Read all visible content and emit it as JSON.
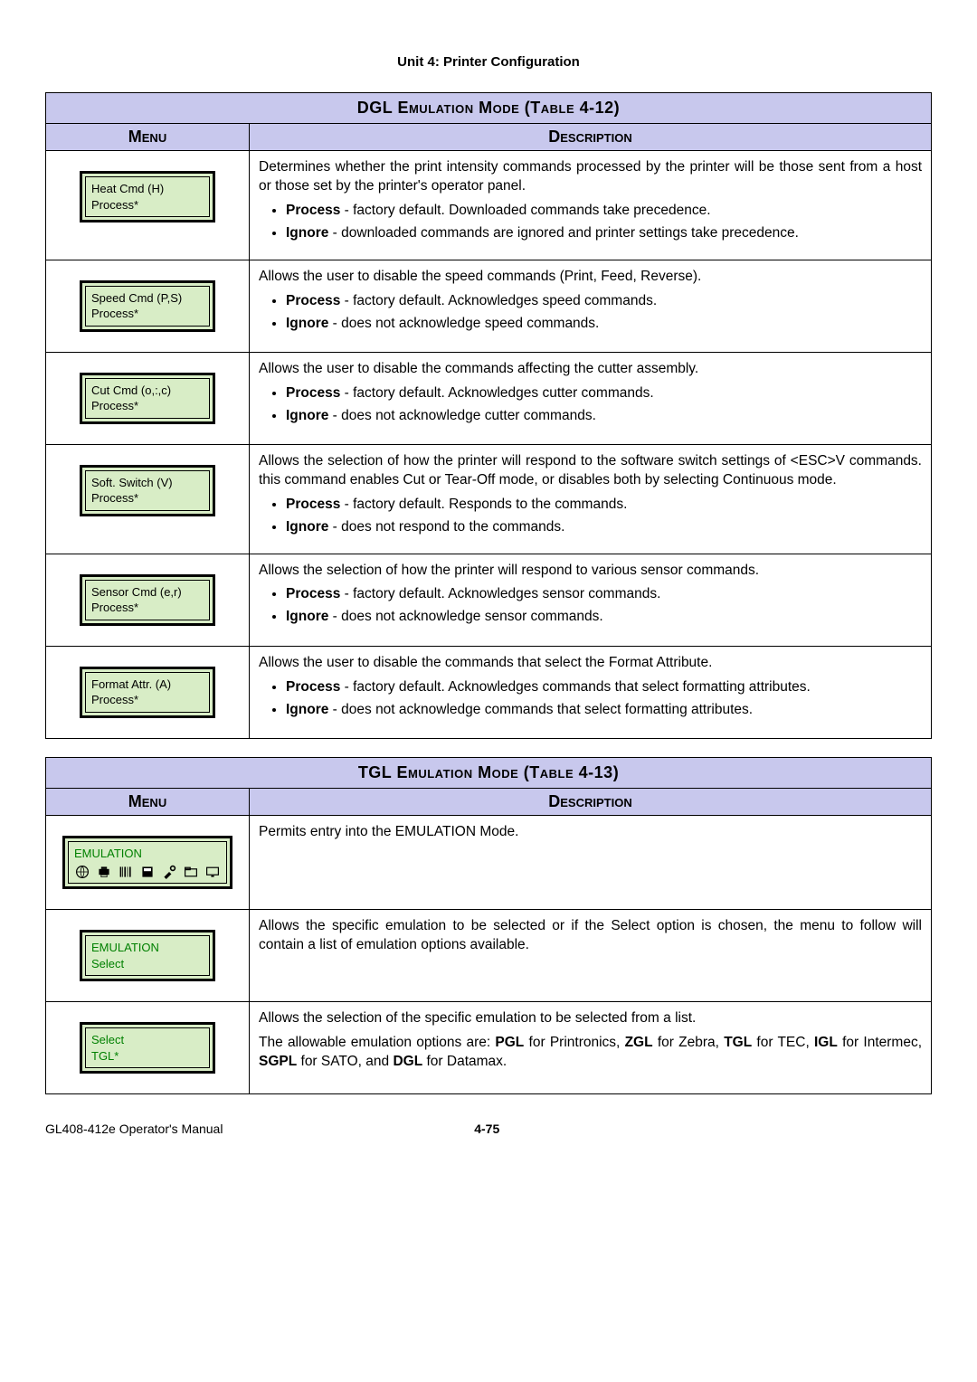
{
  "unit_header": "Unit 4:  Printer Configuration",
  "table1": {
    "title": "DGL Emulation Mode (Table 4-12)",
    "menu_header": "Menu",
    "desc_header": "Description",
    "rows": [
      {
        "menu_line1": "Heat Cmd (H)",
        "menu_line2": "Process*",
        "desc_intro": "Determines whether the print intensity commands processed by the printer will be those sent from a host or those set by the printer's operator panel.",
        "opt1_label": "Process",
        "opt1_text": " - factory default. Downloaded commands take precedence.",
        "opt2_label": "Ignore",
        "opt2_text": " - downloaded commands are ignored and printer settings take precedence."
      },
      {
        "menu_line1": "Speed Cmd (P,S)",
        "menu_line2": "Process*",
        "desc_intro": "Allows the user to disable the speed commands (Print, Feed, Reverse).",
        "opt1_label": "Process",
        "opt1_text": " - factory default. Acknowledges speed commands.",
        "opt2_label": "Ignore",
        "opt2_text": " - does not acknowledge speed commands."
      },
      {
        "menu_line1": "Cut Cmd (o,:,c)",
        "menu_line2": "Process*",
        "desc_intro": "Allows the user to disable the commands affecting the cutter assembly.",
        "opt1_label": "Process",
        "opt1_text": " - factory default. Acknowledges cutter commands.",
        "opt2_label": "Ignore",
        "opt2_text": " - does not acknowledge cutter commands."
      },
      {
        "menu_line1": "Soft. Switch (V)",
        "menu_line2": "Process*",
        "desc_intro": "Allows the selection of how the printer will respond to the software switch settings of <ESC>V commands. this command enables Cut or Tear-Off mode, or disables both by selecting Continuous mode.",
        "opt1_label": "Process",
        "opt1_text": " - factory default. Responds to the commands.",
        "opt2_label": "Ignore",
        "opt2_text": " - does not respond to the commands."
      },
      {
        "menu_line1": "Sensor Cmd (e,r)",
        "menu_line2": "Process*",
        "desc_intro": "Allows the selection of how the printer will respond to various sensor commands.",
        "opt1_label": "Process",
        "opt1_text": " - factory default. Acknowledges sensor commands.",
        "opt2_label": "Ignore",
        "opt2_text": " - does not acknowledge sensor commands."
      },
      {
        "menu_line1": "Format Attr. (A)",
        "menu_line2": "Process*",
        "desc_intro": "Allows the user to disable the commands that select the Format Attribute.",
        "opt1_label": "Process",
        "opt1_text": " - factory default. Acknowledges commands that select formatting attributes.",
        "opt2_label": "Ignore",
        "opt2_text": " - does not acknowledge commands that select formatting attributes."
      }
    ]
  },
  "table2": {
    "title": "TGL Emulation Mode (Table 4-13)",
    "menu_header": "Menu",
    "desc_header": "Description",
    "rows": [
      {
        "menu_line1": "EMULATION",
        "menu_line2": "",
        "has_icons": true,
        "desc_intro": "Permits entry into the EMULATION Mode.",
        "extra": ""
      },
      {
        "menu_line1": "EMULATION",
        "menu_line2": "Select",
        "has_icons": false,
        "desc_intro": "Allows the specific emulation to be selected or if the Select option is chosen, the menu to follow will contain a list of emulation options available.",
        "extra": ""
      },
      {
        "menu_line1": "Select",
        "menu_line2": "TGL*",
        "has_icons": false,
        "desc_intro": "Allows the selection of the specific emulation to be selected from a list.",
        "extra_pre": "The allowable emulation options are: ",
        "b1": "PGL",
        "t1": " for Printronics, ",
        "b2": "ZGL",
        "t2": " for Zebra, ",
        "b3": "TGL",
        "t3": " for TEC, ",
        "b4": "IGL",
        "t4": " for Intermec, ",
        "b5": "SGPL",
        "t5": " for SATO, and ",
        "b6": "DGL",
        "t6": " for Datamax."
      }
    ]
  },
  "footer_left": "GL408-412e Operator's Manual",
  "footer_page": "4-75"
}
